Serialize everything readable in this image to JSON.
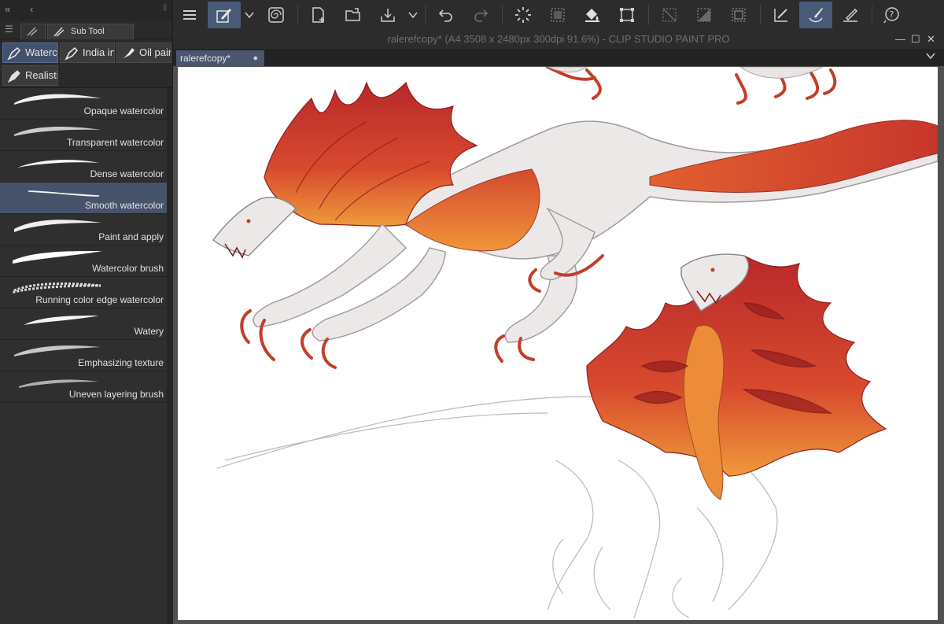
{
  "window": {
    "title": "ralerefcopy* (A4 3508 x 2480px 300dpi 91.6%)  - CLIP STUDIO PAINT PRO"
  },
  "document_tab": {
    "name": "ralerefcopy*",
    "modified_dot": "●"
  },
  "sub_tool_panel": {
    "tab_label": "Sub Tool [Brush]",
    "groups": [
      {
        "label": "Watercolor",
        "selected": true
      },
      {
        "label": "India ink",
        "selected": false
      },
      {
        "label": "Oil paint",
        "selected": false
      },
      {
        "label": "Realistic",
        "selected": false
      }
    ],
    "brushes": [
      {
        "label": "Opaque watercolor",
        "selected": false
      },
      {
        "label": "Transparent watercolor",
        "selected": false
      },
      {
        "label": "Dense watercolor",
        "selected": false
      },
      {
        "label": "Smooth watercolor",
        "selected": true
      },
      {
        "label": "Paint and apply",
        "selected": false
      },
      {
        "label": "Watercolor brush",
        "selected": false
      },
      {
        "label": "Running color edge watercolor",
        "selected": false
      },
      {
        "label": "Watery",
        "selected": false
      },
      {
        "label": "Emphasizing texture",
        "selected": false
      },
      {
        "label": "Uneven layering brush",
        "selected": false
      }
    ]
  },
  "toolbar": {
    "icons": [
      "hamburger-icon",
      "sub-tool-pen-icon",
      "chevron-down-icon",
      "spiral-icon",
      "new-file-icon",
      "open-folder-icon",
      "save-icon",
      "chevron-down-icon",
      "undo-icon",
      "redo-icon",
      "clear-spinner-icon",
      "fill-selection-icon",
      "bucket-icon",
      "transform-icon",
      "deselect-icon",
      "invert-selection-icon",
      "selection-border-icon",
      "pen-check-icon",
      "brush-icon",
      "pen-line-icon",
      "help-icon"
    ]
  },
  "colors": {
    "selected_blue": "#495a78",
    "panel_bg": "#2f2f2f",
    "creature_red": "#c8392b",
    "creature_orange": "#ea8a36"
  }
}
